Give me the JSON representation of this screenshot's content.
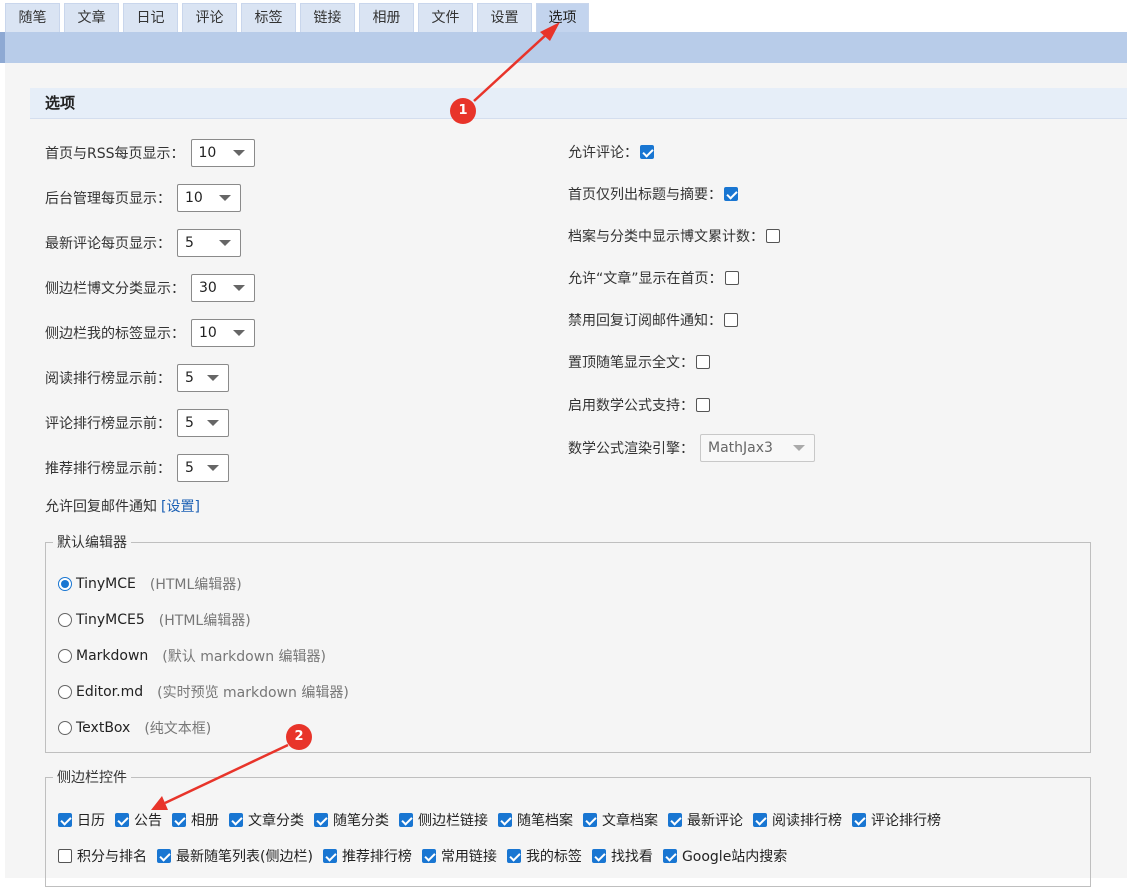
{
  "tabs": [
    "随笔",
    "文章",
    "日记",
    "评论",
    "标签",
    "链接",
    "相册",
    "文件",
    "设置",
    "选项"
  ],
  "active_tab": "选项",
  "section_title": "选项",
  "left_options": [
    {
      "label": "首页与RSS每页显示：",
      "value": "10"
    },
    {
      "label": "后台管理每页显示：",
      "value": "10"
    },
    {
      "label": "最新评论每页显示：",
      "value": "5"
    },
    {
      "label": "侧边栏博文分类显示：",
      "value": "30"
    },
    {
      "label": "侧边栏我的标签显示：",
      "value": "10"
    },
    {
      "label": "阅读排行榜显示前：",
      "value": "5"
    },
    {
      "label": "评论排行榜显示前：",
      "value": "5"
    },
    {
      "label": "推荐排行榜显示前：",
      "value": "5"
    }
  ],
  "reply_notice": {
    "text": "允许回复邮件通知",
    "link": "[设置]"
  },
  "right_options": [
    {
      "label": "允许评论：",
      "checked": true
    },
    {
      "label": "首页仅列出标题与摘要：",
      "checked": true
    },
    {
      "label": "档案与分类中显示博文累计数：",
      "checked": false
    },
    {
      "label": "允许“文章”显示在首页：",
      "checked": false
    },
    {
      "label": "禁用回复订阅邮件通知：",
      "checked": false
    },
    {
      "label": "置顶随笔显示全文：",
      "checked": false
    },
    {
      "label": "启用数学公式支持：",
      "checked": false
    }
  ],
  "math_engine": {
    "label": "数学公式渲染引擎：",
    "value": "MathJax3"
  },
  "editor_group": {
    "legend": "默认编辑器",
    "options": [
      {
        "label": "TinyMCE",
        "note": "(HTML编辑器)",
        "selected": true
      },
      {
        "label": "TinyMCE5",
        "note": "(HTML编辑器)",
        "selected": false
      },
      {
        "label": "Markdown",
        "note": "(默认 markdown 编辑器)",
        "selected": false
      },
      {
        "label": "Editor.md",
        "note": "(实时预览 markdown 编辑器)",
        "selected": false
      },
      {
        "label": "TextBox",
        "note": "(纯文本框)",
        "selected": false
      }
    ]
  },
  "sidebar_group": {
    "legend": "侧边栏控件",
    "row1": [
      {
        "label": "日历",
        "checked": true
      },
      {
        "label": "公告",
        "checked": true
      },
      {
        "label": "相册",
        "checked": true
      },
      {
        "label": "文章分类",
        "checked": true
      },
      {
        "label": "随笔分类",
        "checked": true
      },
      {
        "label": "侧边栏链接",
        "checked": true
      },
      {
        "label": "随笔档案",
        "checked": true
      },
      {
        "label": "文章档案",
        "checked": true
      },
      {
        "label": "最新评论",
        "checked": true
      },
      {
        "label": "阅读排行榜",
        "checked": true
      },
      {
        "label": "评论排行榜",
        "checked": true
      }
    ],
    "row2": [
      {
        "label": "积分与排名",
        "checked": false
      },
      {
        "label": "最新随笔列表(侧边栏)",
        "checked": true
      },
      {
        "label": "推荐排行榜",
        "checked": true
      },
      {
        "label": "常用链接",
        "checked": true
      },
      {
        "label": "我的标签",
        "checked": true
      },
      {
        "label": "找找看",
        "checked": true
      },
      {
        "label": "Google站内搜索",
        "checked": true
      }
    ]
  },
  "annotations": {
    "badge1": "1",
    "badge2": "2",
    "color": "#e8342a"
  }
}
